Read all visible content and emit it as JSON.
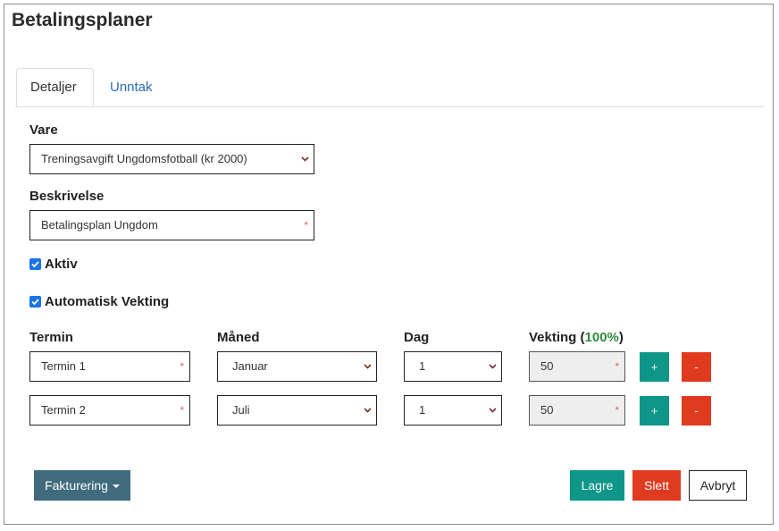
{
  "page": {
    "title": "Betalingsplaner"
  },
  "tabs": [
    {
      "label": "Detaljer",
      "active": true
    },
    {
      "label": "Unntak",
      "active": false
    }
  ],
  "form": {
    "vare": {
      "label": "Vare",
      "value": "Treningsavgift Ungdomsfotball (kr 2000)"
    },
    "beskrivelse": {
      "label": "Beskrivelse",
      "value": "Betalingsplan Ungdom",
      "required_mark": "*"
    },
    "aktiv": {
      "label": "Aktiv",
      "checked": true
    },
    "automatisk_vekting": {
      "label": "Automatisk Vekting",
      "checked": true
    }
  },
  "terms_table": {
    "headers": {
      "termin": "Termin",
      "maned": "Måned",
      "dag": "Dag",
      "vekting": "Vekting",
      "vekting_open": "(",
      "vekting_total": "100%",
      "vekting_close": ")"
    },
    "rows": [
      {
        "termin": "Termin 1",
        "maned": "Januar",
        "dag": "1",
        "vekting": "50",
        "add": "+",
        "remove": "-"
      },
      {
        "termin": "Termin 2",
        "maned": "Juli",
        "dag": "1",
        "vekting": "50",
        "add": "+",
        "remove": "-"
      }
    ],
    "required_mark": "*"
  },
  "footer": {
    "fakturering_label": "Fakturering",
    "lagre_label": "Lagre",
    "slett_label": "Slett",
    "avbryt_label": "Avbryt"
  },
  "colors": {
    "teal": "#0f9688",
    "red": "#e03a1f",
    "dark_button": "#3f6b7c",
    "link": "#2a6db4",
    "percent_green": "#2e8b3a"
  }
}
